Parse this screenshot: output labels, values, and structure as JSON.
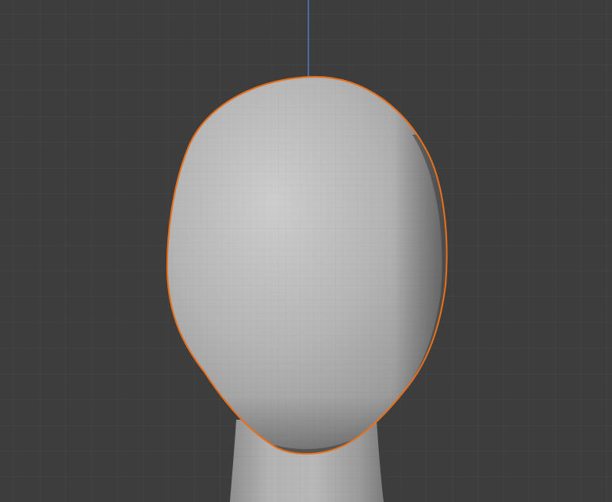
{
  "viewport": {
    "background_color": "#3d3d3d",
    "grid_color": "#464646",
    "z_axis_color": "#4f7cbd",
    "selection_outline_color": "#e8701a",
    "mesh_base_color": "#a4a4a4",
    "mesh_highlight_color": "#cfcfcf",
    "mesh_shadow_color": "#4a4a4a"
  },
  "objects": [
    {
      "name": "head-mesh",
      "selected": true,
      "shading": "solid"
    },
    {
      "name": "neck-mesh",
      "selected": false,
      "shading": "solid"
    }
  ]
}
